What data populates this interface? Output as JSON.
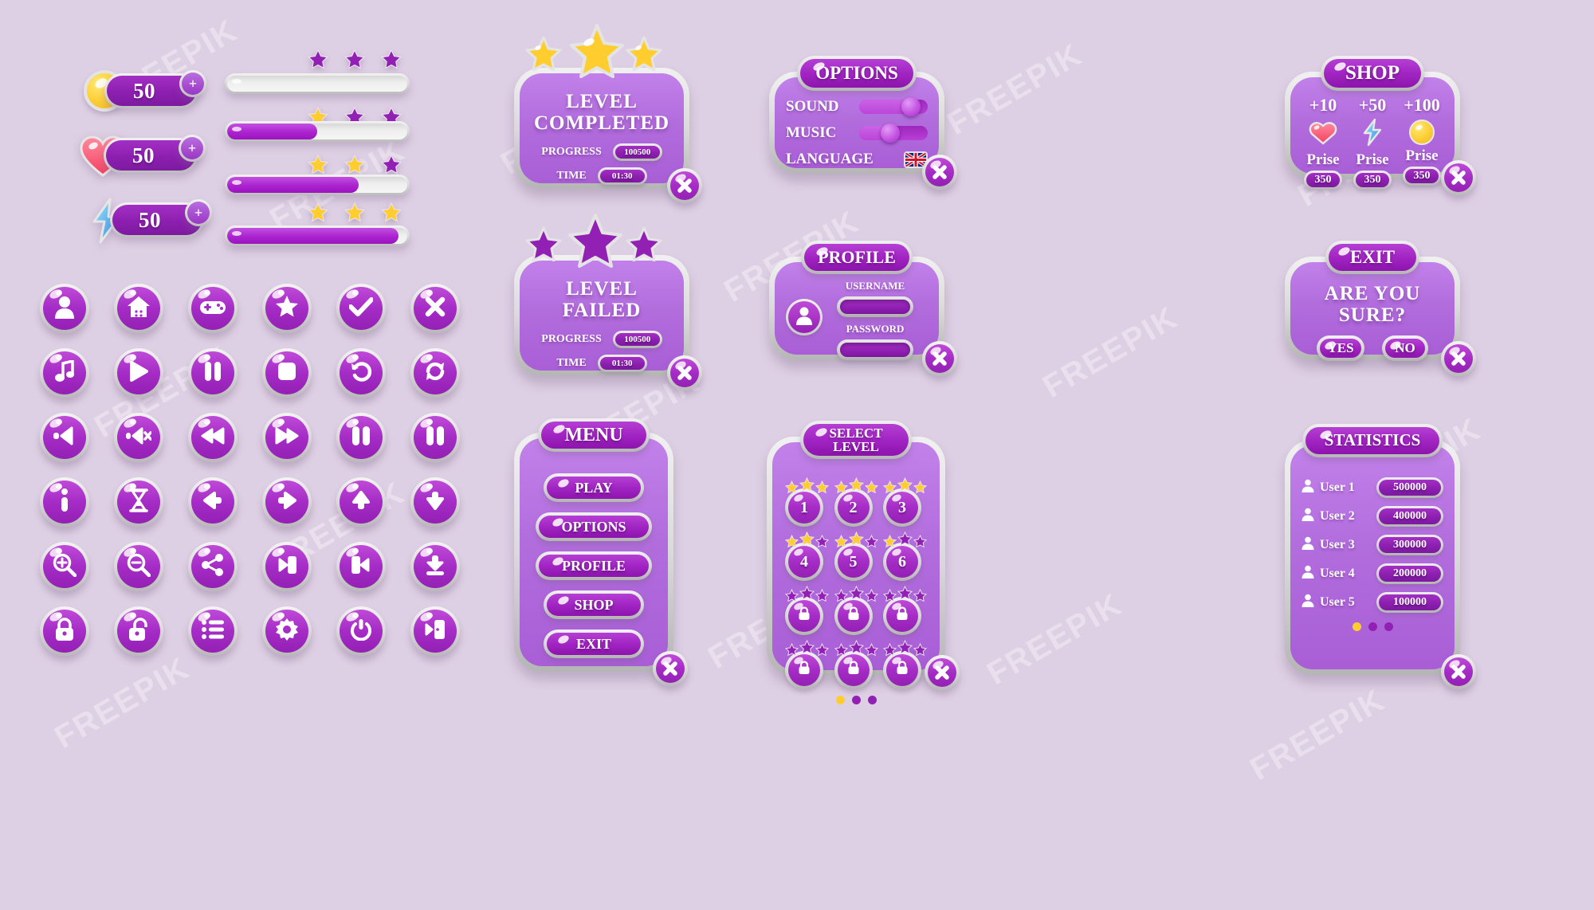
{
  "background": "#ded0e4",
  "accent_purple": "#a52cc6",
  "accent_deep": "#8d1fb0",
  "counters": [
    {
      "icon": "coin-icon",
      "value": "50",
      "plus": "+"
    },
    {
      "icon": "heart-icon",
      "value": "50",
      "plus": "+"
    },
    {
      "icon": "lightning-icon",
      "value": "50",
      "plus": "+"
    }
  ],
  "progress_bars": [
    {
      "fill_percent": 0,
      "stars": [
        "empty",
        "empty",
        "empty"
      ]
    },
    {
      "fill_percent": 50,
      "stars": [
        "filled",
        "empty",
        "empty"
      ]
    },
    {
      "fill_percent": 73,
      "stars": [
        "filled",
        "filled",
        "empty"
      ]
    },
    {
      "fill_percent": 95,
      "stars": [
        "filled",
        "filled",
        "filled"
      ]
    }
  ],
  "icon_buttons": [
    [
      "user-icon",
      "home-icon",
      "gamepad-icon",
      "star-icon",
      "check-icon",
      "close-icon"
    ],
    [
      "music-note-icon",
      "play-icon",
      "pause-icon",
      "stop-icon",
      "undo-icon",
      "refresh-icon"
    ],
    [
      "volume-icon",
      "volume-mute-icon",
      "rewind-icon",
      "fast-forward-icon",
      "pause-alt-icon",
      "pause-alt2-icon"
    ],
    [
      "info-icon",
      "hourglass-icon",
      "arrow-left-icon",
      "arrow-right-icon",
      "arrow-up-icon",
      "arrow-down-icon"
    ],
    [
      "zoom-in-icon",
      "zoom-out-icon",
      "share-icon",
      "login-icon",
      "logout-icon",
      "download-icon"
    ],
    [
      "lock-icon",
      "unlock-icon",
      "list-icon",
      "gear-icon",
      "power-icon",
      "exit-door-icon"
    ]
  ],
  "level_completed": {
    "title": "LEVEL\nCOMPLETED",
    "title_line1": "LEVEL",
    "title_line2": "COMPLETED",
    "stars": [
      "filled",
      "filled",
      "filled"
    ],
    "rows": [
      {
        "label": "PROGRESS",
        "value": "100500"
      },
      {
        "label": "TIME",
        "value": "01:30"
      }
    ],
    "close": "close-icon"
  },
  "level_failed": {
    "title_line1": "LEVEL",
    "title_line2": "FAILED",
    "stars": [
      "empty",
      "empty",
      "empty"
    ],
    "rows": [
      {
        "label": "PROGRESS",
        "value": "100500"
      },
      {
        "label": "TIME",
        "value": "01:30"
      }
    ],
    "close": "close-icon"
  },
  "menu": {
    "title": "MENU",
    "buttons": [
      "PLAY",
      "OPTIONS",
      "PROFILE",
      "SHOP",
      "EXIT"
    ],
    "close": "close-icon"
  },
  "options": {
    "title": "OPTIONS",
    "rows": [
      {
        "label": "SOUND",
        "type": "slider",
        "value": 76
      },
      {
        "label": "MUSIC",
        "type": "slider",
        "value": 45
      },
      {
        "label": "LANGUAGE",
        "type": "flag",
        "flag": "uk-flag-icon"
      }
    ],
    "close": "close-icon"
  },
  "profile": {
    "title": "PROFILE",
    "avatar": "avatar-icon",
    "fields": [
      {
        "label": "USERNAME",
        "value": ""
      },
      {
        "label": "PASSWORD",
        "value": ""
      }
    ],
    "close": "close-icon"
  },
  "select_level": {
    "title_line1": "SELECT",
    "title_line2": "LEVEL",
    "levels": [
      {
        "number": "1",
        "stars": [
          "filled",
          "filled",
          "filled"
        ],
        "locked": false
      },
      {
        "number": "2",
        "stars": [
          "filled",
          "filled",
          "filled"
        ],
        "locked": false
      },
      {
        "number": "3",
        "stars": [
          "filled",
          "filled",
          "filled"
        ],
        "locked": false
      },
      {
        "number": "4",
        "stars": [
          "filled",
          "filled",
          "empty"
        ],
        "locked": false
      },
      {
        "number": "5",
        "stars": [
          "filled",
          "filled",
          "empty"
        ],
        "locked": false
      },
      {
        "number": "6",
        "stars": [
          "filled",
          "empty",
          "empty"
        ],
        "locked": false
      },
      {
        "number": "",
        "stars": [
          "empty",
          "empty",
          "empty"
        ],
        "locked": true
      },
      {
        "number": "",
        "stars": [
          "empty",
          "empty",
          "empty"
        ],
        "locked": true
      },
      {
        "number": "",
        "stars": [
          "empty",
          "empty",
          "empty"
        ],
        "locked": true
      },
      {
        "number": "",
        "stars": [
          "empty",
          "empty",
          "empty"
        ],
        "locked": true
      },
      {
        "number": "",
        "stars": [
          "empty",
          "empty",
          "empty"
        ],
        "locked": true
      },
      {
        "number": "",
        "stars": [
          "empty",
          "empty",
          "empty"
        ],
        "locked": true
      }
    ],
    "pagination": [
      "active",
      "inactive",
      "inactive"
    ],
    "close": "close-icon"
  },
  "shop": {
    "title": "SHOP",
    "items": [
      {
        "amount": "+10",
        "icon": "heart-icon",
        "price_label": "Prise",
        "price": "350"
      },
      {
        "amount": "+50",
        "icon": "lightning-icon",
        "price_label": "Prise",
        "price": "350"
      },
      {
        "amount": "+100",
        "icon": "coin-icon",
        "price_label": "Prise",
        "price": "350"
      }
    ],
    "close": "close-icon"
  },
  "exit": {
    "title": "EXIT",
    "question_line1": "ARE YOU",
    "question_line2": "SURE?",
    "buttons": [
      "YES",
      "NO"
    ],
    "close": "close-icon"
  },
  "statistics": {
    "title": "STATISTICS",
    "rows": [
      {
        "icon": "user-icon",
        "name": "User 1",
        "score": "500000"
      },
      {
        "icon": "user-icon",
        "name": "User 2",
        "score": "400000"
      },
      {
        "icon": "user-icon",
        "name": "User 3",
        "score": "300000"
      },
      {
        "icon": "user-icon",
        "name": "User 4",
        "score": "200000"
      },
      {
        "icon": "user-icon",
        "name": "User 5",
        "score": "100000"
      }
    ],
    "pagination": [
      "active",
      "inactive",
      "inactive"
    ],
    "close": "close-icon"
  },
  "watermark": "FREEPIK"
}
